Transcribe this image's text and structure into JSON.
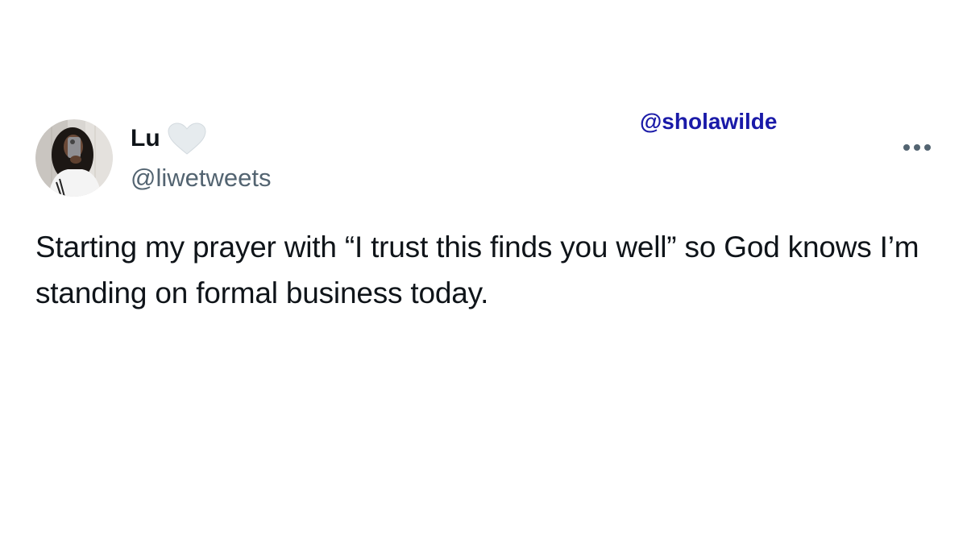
{
  "tweet": {
    "author": {
      "display_name": "Lu",
      "handle": "@liwetweets",
      "name_emoji_icon": "white-heart-icon",
      "avatar": "avatar-photo"
    },
    "text": "Starting my prayer with “I trust this finds you well” so God knows I’m standing on formal business today.",
    "more_icon": "more-options-icon"
  },
  "watermark": {
    "text": "@sholawilde",
    "color": "#1a1aa8"
  },
  "colors": {
    "text_primary": "#0f1419",
    "text_secondary": "#536471",
    "background": "#ffffff"
  }
}
